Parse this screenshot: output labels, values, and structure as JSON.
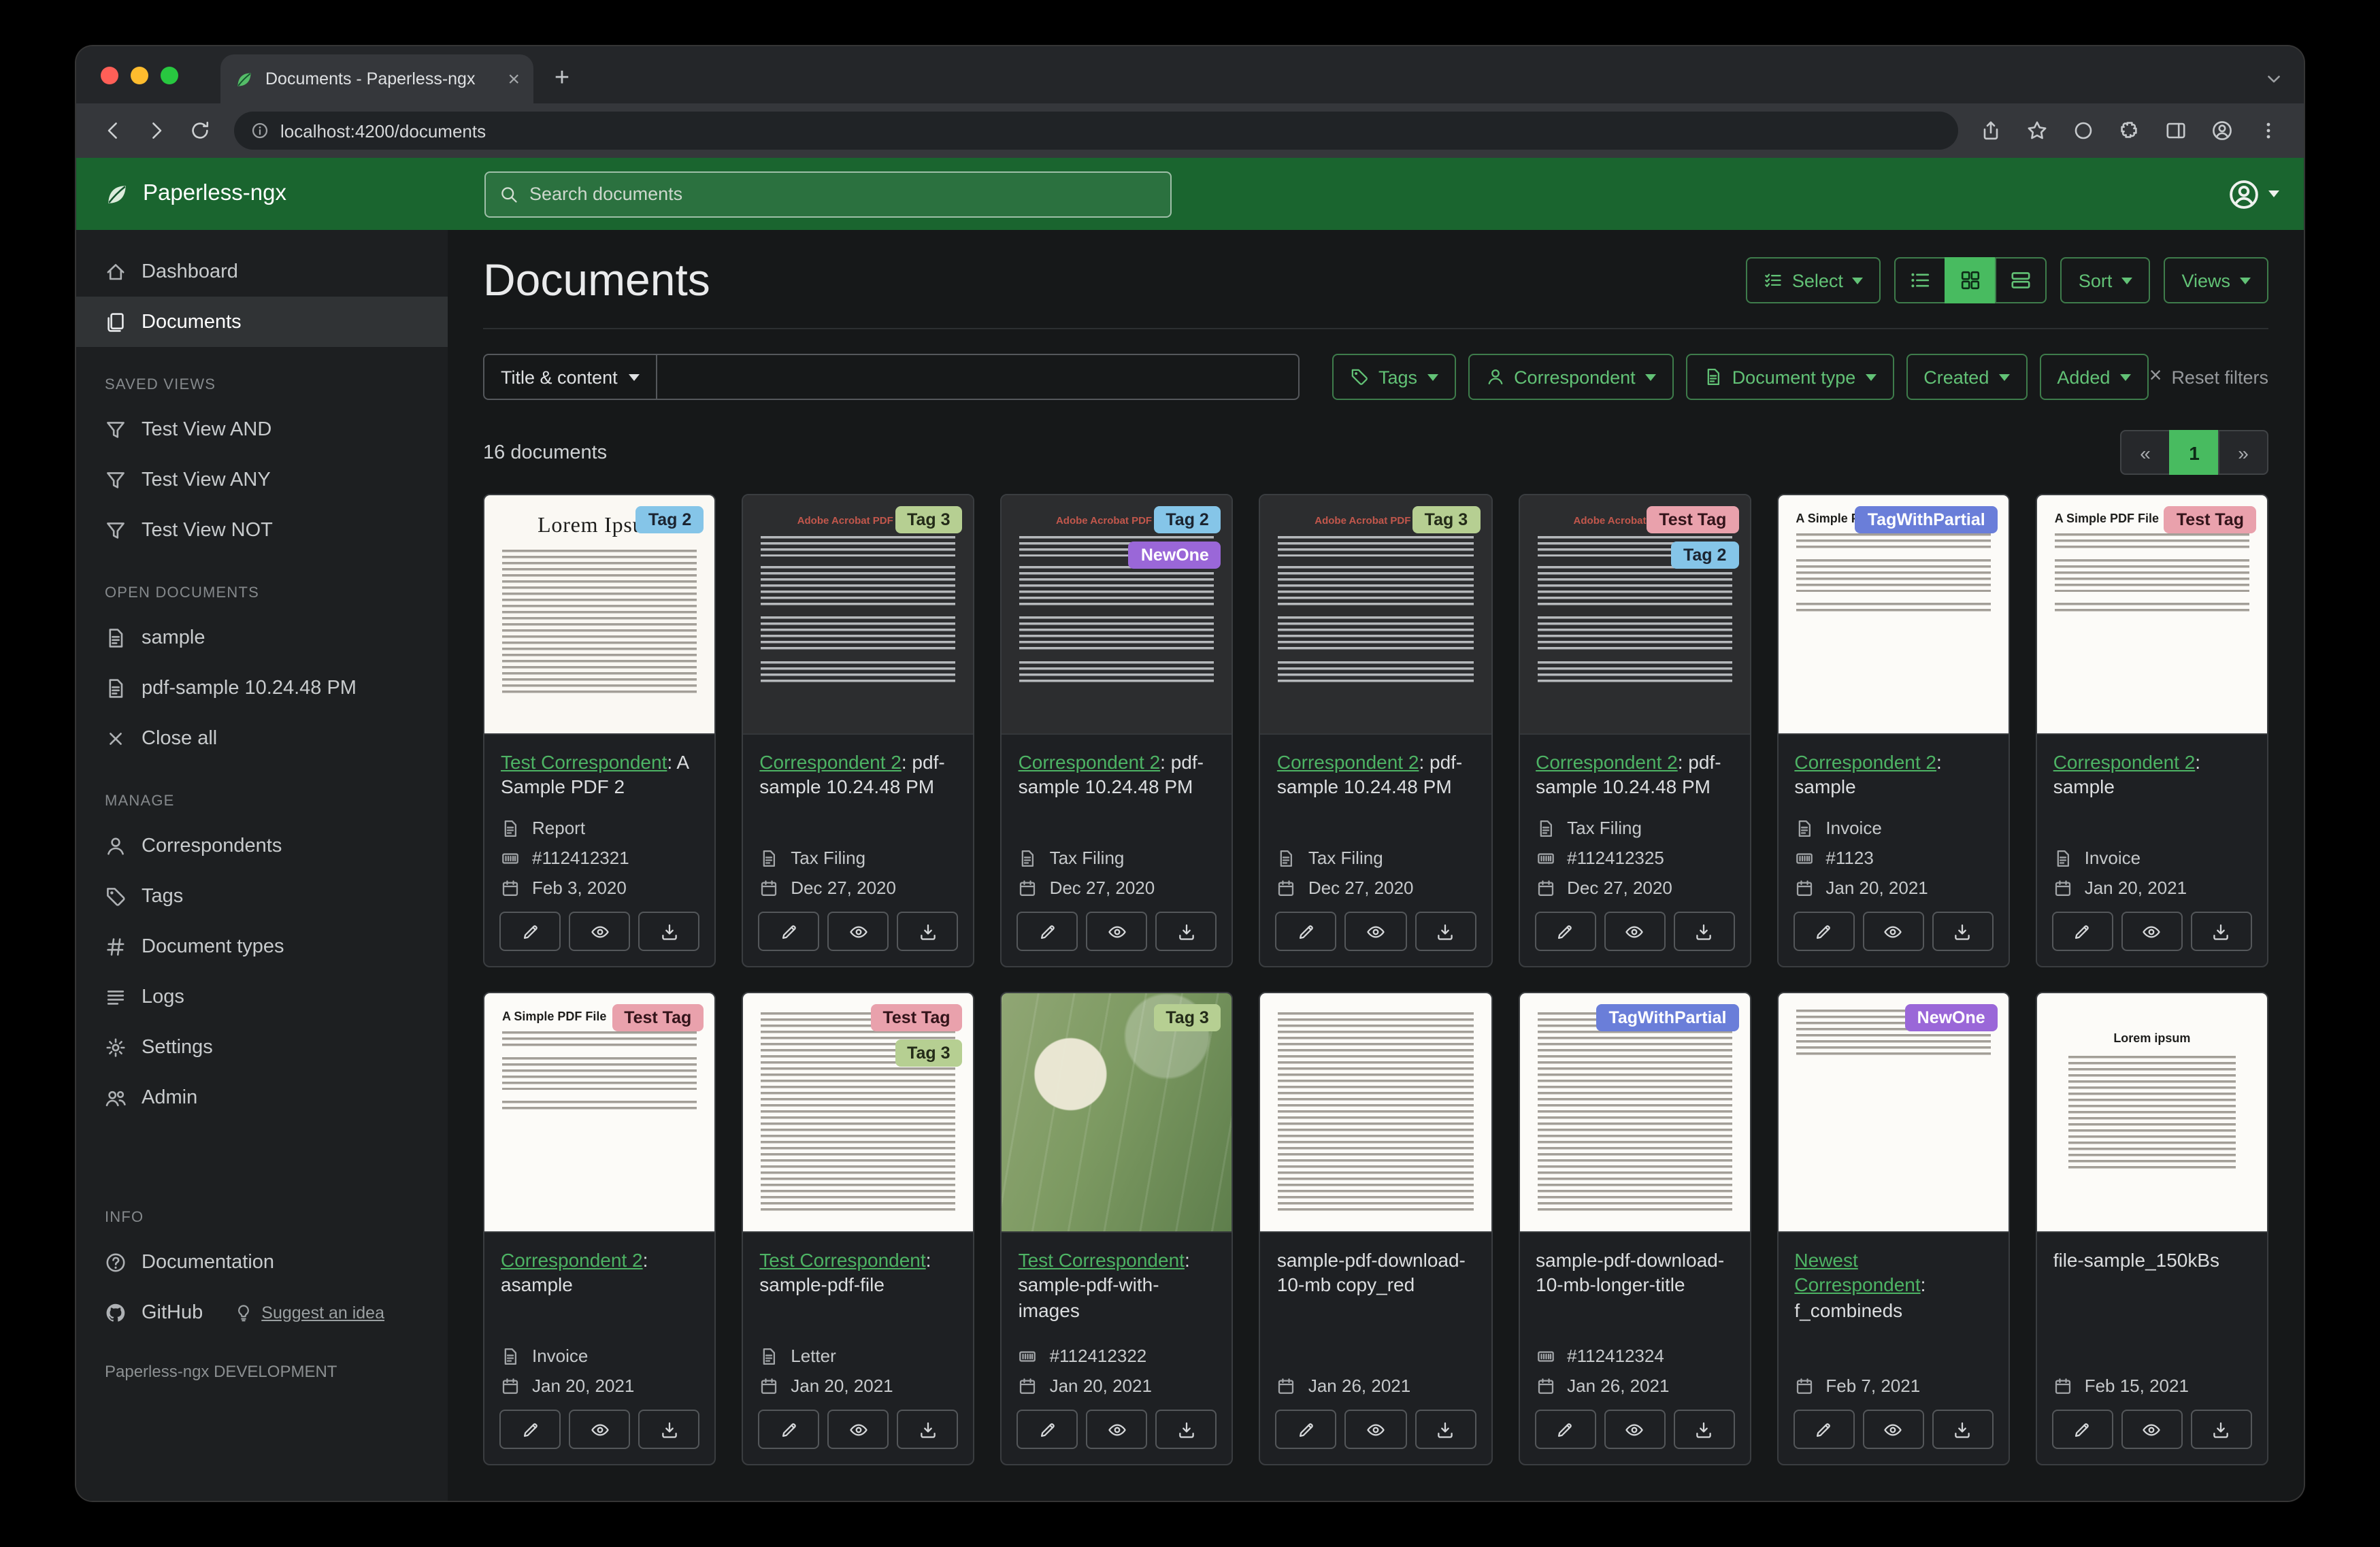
{
  "browser": {
    "tab_title": "Documents - Paperless-ngx",
    "url": "localhost:4200/documents"
  },
  "header": {
    "app_name": "Paperless-ngx",
    "search_placeholder": "Search documents"
  },
  "sidebar": {
    "items_top": [
      {
        "label": "Dashboard",
        "icon": "house",
        "active": false
      },
      {
        "label": "Documents",
        "icon": "files",
        "active": true
      }
    ],
    "sections": [
      {
        "title": "SAVED VIEWS",
        "items": [
          {
            "label": "Test View AND",
            "icon": "funnel"
          },
          {
            "label": "Test View ANY",
            "icon": "funnel"
          },
          {
            "label": "Test View NOT",
            "icon": "funnel"
          }
        ]
      },
      {
        "title": "OPEN DOCUMENTS",
        "items": [
          {
            "label": "sample",
            "icon": "file-text"
          },
          {
            "label": "pdf-sample 10.24.48 PM",
            "icon": "file-text"
          },
          {
            "label": "Close all",
            "icon": "x"
          }
        ]
      },
      {
        "title": "MANAGE",
        "items": [
          {
            "label": "Correspondents",
            "icon": "person"
          },
          {
            "label": "Tags",
            "icon": "tag"
          },
          {
            "label": "Document types",
            "icon": "hash"
          },
          {
            "label": "Logs",
            "icon": "list"
          },
          {
            "label": "Settings",
            "icon": "gear"
          },
          {
            "label": "Admin",
            "icon": "people"
          }
        ]
      },
      {
        "title": "INFO",
        "items": [
          {
            "label": "Documentation",
            "icon": "question"
          },
          {
            "label": "GitHub",
            "icon": "github",
            "extra": {
              "label": "Suggest an idea",
              "icon": "bulb"
            }
          }
        ]
      }
    ],
    "footer": "Paperless-ngx DEVELOPMENT"
  },
  "main": {
    "title": "Documents",
    "toolbar": {
      "select": "Select",
      "sort": "Sort",
      "views": "Views"
    },
    "filters": {
      "field_selector": "Title & content",
      "buttons": [
        {
          "label": "Tags",
          "icon": "tag"
        },
        {
          "label": "Correspondent",
          "icon": "person"
        },
        {
          "label": "Document type",
          "icon": "doc"
        },
        {
          "label": "Created"
        },
        {
          "label": "Added"
        }
      ],
      "reset": "Reset filters"
    },
    "count_text": "16 documents",
    "pagination": {
      "prev": "«",
      "current": "1",
      "next": "»"
    }
  },
  "colors": {
    "brand_green": "#1a652f",
    "accent_green": "#4db364"
  },
  "tag_colors": {
    "Tag 2": {
      "bg": "#85c5e8",
      "fg": "#1b2430"
    },
    "Tag 3": {
      "bg": "#b6cf92",
      "fg": "#232b18"
    },
    "NewOne": {
      "bg": "#9a67d8",
      "fg": "#ffffff"
    },
    "Test Tag": {
      "bg": "#e9a1ac",
      "fg": "#33141a"
    },
    "TagWithPartial": {
      "bg": "#6a7ed9",
      "fg": "#ffffff"
    }
  },
  "documents": [
    {
      "tags": [
        "Tag 2"
      ],
      "correspondent": "Test Correspondent",
      "title_suffix": ": A Sample PDF 2",
      "type": "Report",
      "asn": "#112412321",
      "date": "Feb 3, 2020",
      "thumb": {
        "kind": "lorem",
        "heading": "Lorem Ipsum"
      }
    },
    {
      "tags": [
        "Tag 3"
      ],
      "correspondent": "Correspondent 2",
      "title_suffix": ": pdf-sample 10.24.48 PM",
      "type": "Tax Filing",
      "date": "Dec 27, 2020",
      "thumb": {
        "kind": "acrobat",
        "heading": "Adobe Acrobat PDF Files"
      }
    },
    {
      "tags": [
        "Tag 2",
        "NewOne"
      ],
      "correspondent": "Correspondent 2",
      "title_suffix": ": pdf-sample 10.24.48 PM",
      "type": "Tax Filing",
      "date": "Dec 27, 2020",
      "thumb": {
        "kind": "acrobat",
        "heading": "Adobe Acrobat PDF Files"
      }
    },
    {
      "tags": [
        "Tag 3"
      ],
      "correspondent": "Correspondent 2",
      "title_suffix": ": pdf-sample 10.24.48 PM",
      "type": "Tax Filing",
      "date": "Dec 27, 2020",
      "thumb": {
        "kind": "acrobat",
        "heading": "Adobe Acrobat PDF Files"
      }
    },
    {
      "tags": [
        "Test Tag",
        "Tag 2"
      ],
      "correspondent": "Correspondent 2",
      "title_suffix": ": pdf-sample 10.24.48 PM",
      "type": "Tax Filing",
      "asn": "#112412325",
      "date": "Dec 27, 2020",
      "thumb": {
        "kind": "acrobat",
        "heading": "Adobe Acrobat PDF Files"
      }
    },
    {
      "tags": [
        "TagWithPartial"
      ],
      "correspondent": "Correspondent 2",
      "title_suffix": ": sample",
      "type": "Invoice",
      "asn": "#1123",
      "date": "Jan 20, 2021",
      "thumb": {
        "kind": "simple",
        "heading": "A Simple PDF File"
      }
    },
    {
      "tags": [
        "Test Tag"
      ],
      "correspondent": "Correspondent 2",
      "title_suffix": ": sample",
      "type": "Invoice",
      "date": "Jan 20, 2021",
      "thumb": {
        "kind": "simple",
        "heading": "A Simple PDF File"
      }
    },
    {
      "tags": [
        "Test Tag"
      ],
      "correspondent": "Correspondent 2",
      "title_suffix": ": asample",
      "type": "Invoice",
      "date": "Jan 20, 2021",
      "thumb": {
        "kind": "simple",
        "heading": "A Simple PDF File"
      }
    },
    {
      "tags": [
        "Test Tag",
        "Tag 3"
      ],
      "correspondent": "Test Correspondent",
      "title_suffix": ": sample-pdf-file",
      "type": "Letter",
      "date": "Jan 20, 2021",
      "thumb": {
        "kind": "dense"
      }
    },
    {
      "tags": [
        "Tag 3"
      ],
      "correspondent": "Test Correspondent",
      "title_suffix": ": sample-pdf-with-images",
      "asn": "#112412322",
      "date": "Jan 20, 2021",
      "thumb": {
        "kind": "map"
      }
    },
    {
      "tags": [],
      "correspondent": null,
      "title": "sample-pdf-download-10-mb copy_red",
      "date": "Jan 26, 2021",
      "thumb": {
        "kind": "dense"
      }
    },
    {
      "tags": [
        "TagWithPartial"
      ],
      "correspondent": null,
      "title": "sample-pdf-download-10-mb-longer-title",
      "asn": "#112412324",
      "date": "Jan 26, 2021",
      "thumb": {
        "kind": "dense"
      }
    },
    {
      "tags": [
        "NewOne"
      ],
      "correspondent": "Newest Correspondent",
      "title_suffix": ": f_combineds",
      "date": "Feb 7, 2021",
      "thumb": {
        "kind": "blank-top"
      }
    },
    {
      "tags": [],
      "correspondent": null,
      "title": "file-sample_150kBs",
      "date": "Feb 15, 2021",
      "thumb": {
        "kind": "lorem-center",
        "heading": "Lorem ipsum"
      }
    }
  ]
}
